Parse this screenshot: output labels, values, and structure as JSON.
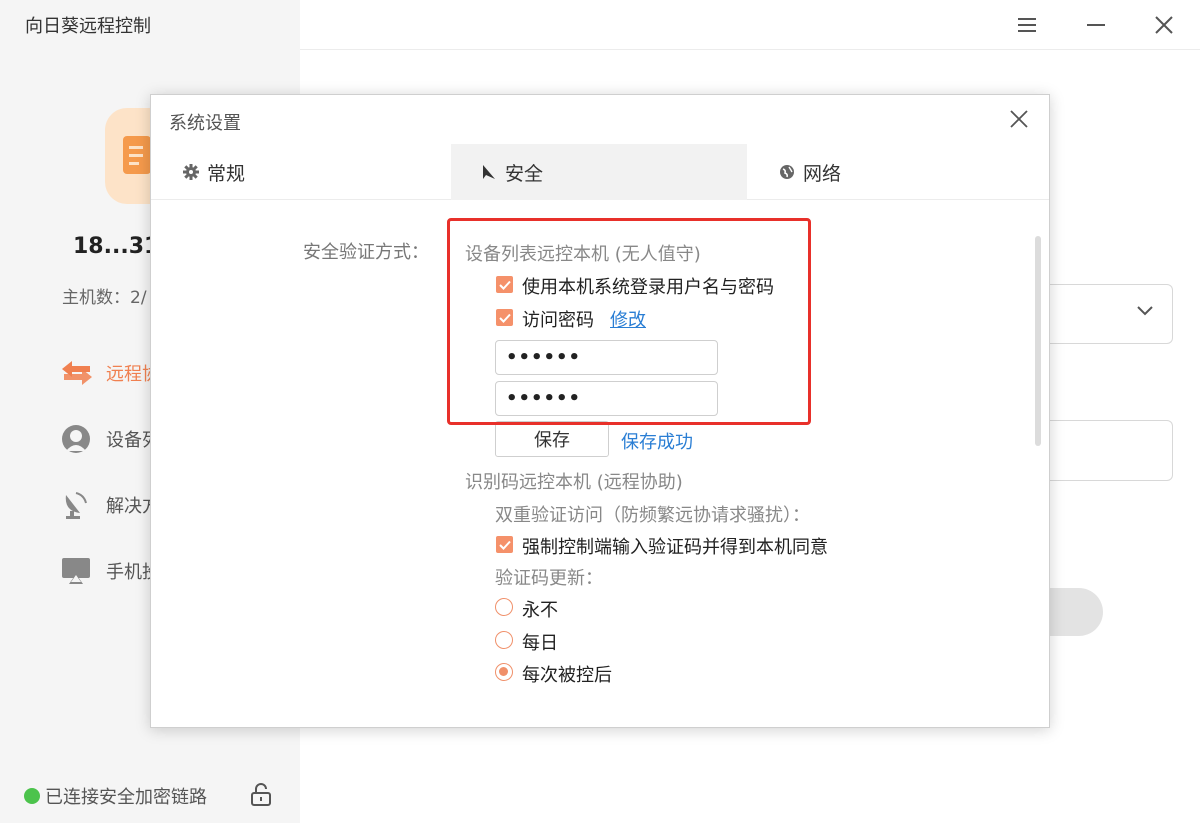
{
  "app": {
    "title": "向日葵远程控制",
    "device_name": "18...31",
    "host_count": "主机数：2/",
    "status": "已连接安全加密链路",
    "accent": "#f08050"
  },
  "nav": {
    "items": [
      {
        "label": "远程协",
        "icon": "remote-arrows-icon"
      },
      {
        "label": "设备列",
        "icon": "device-list-icon"
      },
      {
        "label": "解决方",
        "icon": "satellite-dish-icon"
      },
      {
        "label": "手机投",
        "icon": "screen-cast-icon"
      }
    ]
  },
  "dialog": {
    "title": "系统设置",
    "tabs": [
      {
        "label": "常规",
        "icon": "gear-icon"
      },
      {
        "label": "安全",
        "icon": "security-icon"
      },
      {
        "label": "网络",
        "icon": "globe-icon"
      }
    ],
    "active_tab": "安全",
    "security": {
      "label": "安全验证方式：",
      "device_list_title": "设备列表远控本机 (无人值守)",
      "use_system_login": "使用本机系统登录用户名与密码",
      "access_password": "访问密码",
      "modify_link": "修改",
      "password1": "••••••",
      "password2": "••••••",
      "save_button": "保存",
      "save_status": "保存成功",
      "id_code_title": "识别码远控本机 (远程协助)",
      "two_factor_label": "双重验证访问（防频繁远协请求骚扰）：",
      "force_verify": "强制控制端输入验证码并得到本机同意",
      "code_update_label": "验证码更新：",
      "options": [
        "永不",
        "每日",
        "每次被控后"
      ],
      "selected_option": "每次被控后"
    }
  }
}
